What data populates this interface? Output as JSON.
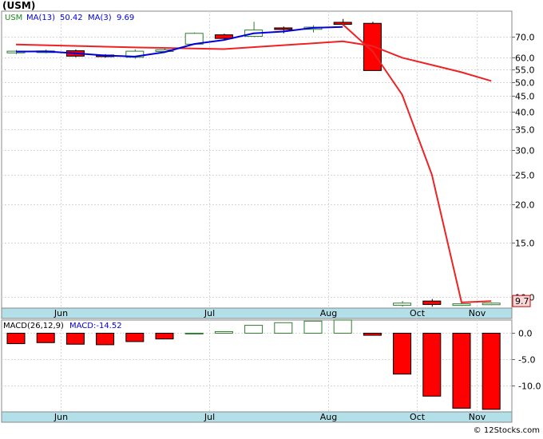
{
  "title": "(USM)",
  "footer": "© 12Stocks.com",
  "colors": {
    "up_candle": "#2e7d32",
    "down_candle": "#ff0000",
    "ma_fast": "#0000dd",
    "ma_slow": "#ee2222",
    "axis_band": "#b3dfe8",
    "grid": "#d6d6d6",
    "last_price_box": "#f8d8d8"
  },
  "chart_data": [
    {
      "type": "candlestick",
      "scale": "log",
      "ylim": [
        9.2,
        85
      ],
      "yticks": [
        70,
        60,
        55,
        50,
        45,
        40,
        35,
        30,
        25,
        20,
        15,
        10
      ],
      "ytick_labels": [
        "70.0",
        "60.0",
        "55.0",
        "50.0",
        "45.0",
        "40.0",
        "35.0",
        "30.0",
        "25.0",
        "20.0",
        "15.0",
        "10.0"
      ],
      "months": [
        {
          "label": "Jun",
          "after": 1
        },
        {
          "label": "Jul",
          "after": 6
        },
        {
          "label": "Aug",
          "after": 10
        },
        {
          "label": "Oct",
          "after": 13
        },
        {
          "label": "Nov",
          "after": 15
        }
      ],
      "legend": {
        "symbol": "USM",
        "ma_fast_label": "MA(13)",
        "ma_fast_value": "50.42",
        "ma_slow_label": "MA(3)",
        "ma_slow_value": "9.69"
      },
      "last_price": "9.7",
      "candles": [
        {
          "o": 62.2,
          "c": 63.0,
          "h": 63.6,
          "l": 61.6
        },
        {
          "o": 62.6,
          "c": 63.1,
          "h": 63.8,
          "l": 62.0
        },
        {
          "o": 63.2,
          "c": 60.7,
          "h": 63.8,
          "l": 60.2
        },
        {
          "o": 61.2,
          "c": 60.6,
          "h": 61.6,
          "l": 60.0
        },
        {
          "o": 60.2,
          "c": 63.0,
          "h": 63.8,
          "l": 59.5
        },
        {
          "o": 63.1,
          "c": 63.6,
          "h": 64.5,
          "l": 62.2
        },
        {
          "o": 66.4,
          "c": 72.0,
          "h": 72.5,
          "l": 66.0
        },
        {
          "o": 71.2,
          "c": 69.3,
          "h": 71.8,
          "l": 68.6
        },
        {
          "o": 70.4,
          "c": 73.8,
          "h": 78.5,
          "l": 70.0
        },
        {
          "o": 75.0,
          "c": 74.5,
          "h": 75.8,
          "l": 72.0
        },
        {
          "o": 74.2,
          "c": 75.4,
          "h": 76.5,
          "l": 72.5
        },
        {
          "o": 78.2,
          "c": 77.0,
          "h": 80.2,
          "l": 76.2
        },
        {
          "o": 77.6,
          "c": 54.5,
          "h": 78.5,
          "l": 54.5
        },
        {
          "o": 9.4,
          "c": 9.55,
          "h": 9.7,
          "l": 9.3
        },
        {
          "o": 9.7,
          "c": 9.45,
          "h": 9.85,
          "l": 9.3
        },
        {
          "o": 9.45,
          "c": 9.5,
          "h": 9.55,
          "l": 9.35
        },
        {
          "o": 9.5,
          "c": 9.55,
          "h": 9.6,
          "l": 9.4
        }
      ],
      "ma_fast": [
        {
          "i": 0,
          "v": 62.8
        },
        {
          "i": 1,
          "v": 62.9
        },
        {
          "i": 2,
          "v": 62.0
        },
        {
          "i": 3,
          "v": 61.0
        },
        {
          "i": 4,
          "v": 60.5
        },
        {
          "i": 5,
          "v": 62.5
        },
        {
          "i": 6,
          "v": 66.5
        },
        {
          "i": 7,
          "v": 68.5
        },
        {
          "i": 8,
          "v": 72.0
        },
        {
          "i": 9,
          "v": 73.0
        },
        {
          "i": 10,
          "v": 75.0
        },
        {
          "i": 11,
          "v": 75.5
        }
      ],
      "ma_slow": [
        {
          "i": 0,
          "v": 66.2
        },
        {
          "i": 4,
          "v": 64.8
        },
        {
          "i": 7,
          "v": 64.0
        },
        {
          "i": 11,
          "v": 67.8
        },
        {
          "i": 12,
          "v": 65.5
        },
        {
          "i": 13,
          "v": 60.0
        },
        {
          "i": 14,
          "v": 56.8
        },
        {
          "i": 15,
          "v": 53.8
        },
        {
          "i": 16,
          "v": 50.4
        }
      ],
      "ma_slow_drop": [
        {
          "i": 11,
          "v": 77.0
        },
        {
          "i": 12,
          "v": 63.0
        },
        {
          "i": 13,
          "v": 45.5
        },
        {
          "i": 14,
          "v": 25.0
        },
        {
          "i": 15,
          "v": 9.6
        },
        {
          "i": 16,
          "v": 9.69
        }
      ]
    },
    {
      "type": "bar",
      "title": "MACD(26,12,9)",
      "value_label": "MACD:-14.52",
      "ylim": [
        -15,
        2.5
      ],
      "yticks": [
        0,
        -5,
        -10
      ],
      "ytick_labels": [
        "0.0",
        "-5.0",
        "-10.0"
      ],
      "values": [
        -2.0,
        -1.8,
        -2.1,
        -2.2,
        -1.6,
        -1.1,
        0.0,
        0.3,
        1.5,
        2.0,
        2.3,
        2.5,
        -0.4,
        -7.8,
        -12.0,
        -14.3,
        -14.52
      ]
    }
  ]
}
